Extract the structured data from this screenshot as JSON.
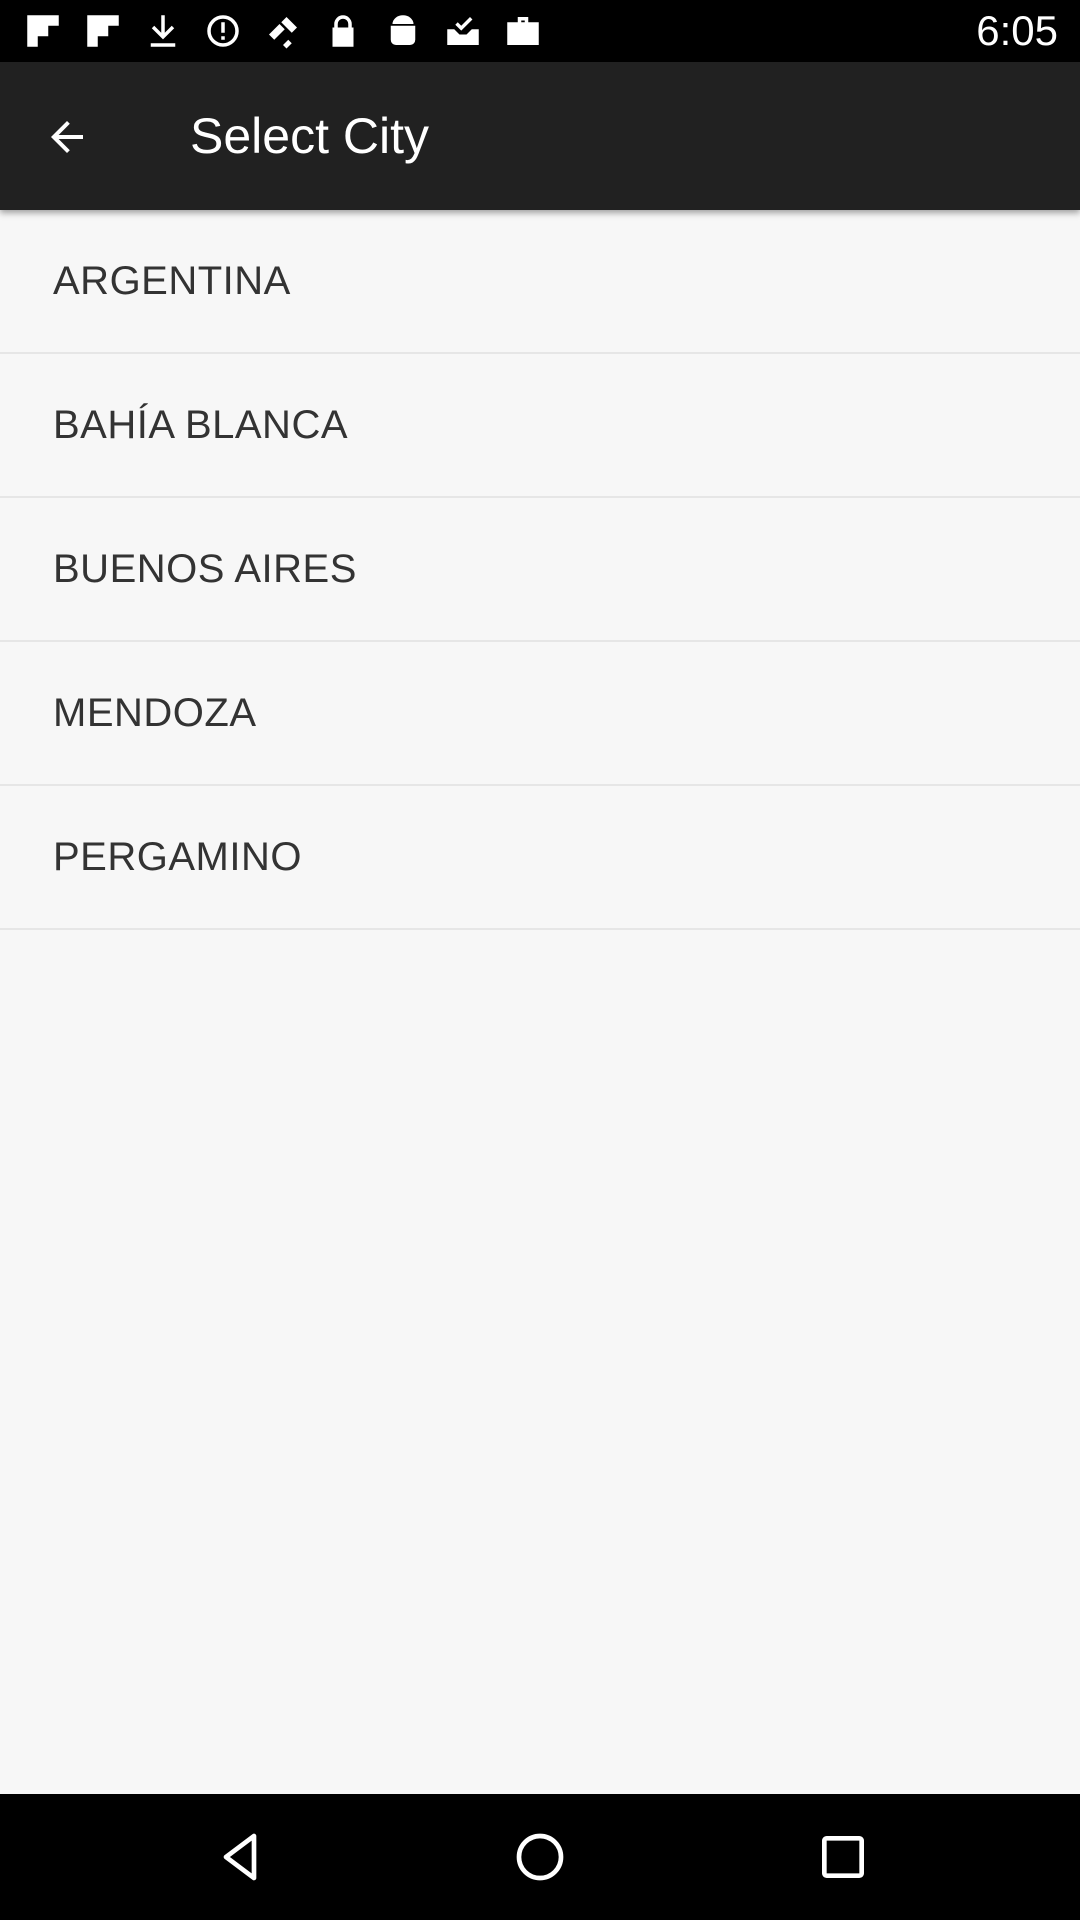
{
  "status_bar": {
    "time": "6:05",
    "icons": [
      "flipboard-icon",
      "flipboard-icon",
      "download-icon",
      "sync-disabled-icon",
      "fake-gps-icon",
      "lock-icon",
      "android-icon",
      "task-done-icon",
      "briefcase-icon"
    ]
  },
  "app_bar": {
    "title": "Select City",
    "back_icon": "arrow-back-icon"
  },
  "cities": [
    {
      "label": "ARGENTINA"
    },
    {
      "label": "BAHÍA BLANCA"
    },
    {
      "label": "BUENOS AIRES"
    },
    {
      "label": "MENDOZA"
    },
    {
      "label": "PERGAMINO"
    }
  ],
  "nav_bar": {
    "icons": [
      "back-triangle-icon",
      "home-circle-icon",
      "recents-square-icon"
    ]
  },
  "colors": {
    "status_bar": "#000000",
    "app_bar": "#212121",
    "background": "#f7f7f7",
    "divider": "#e6e6e6",
    "item_text": "#333333"
  }
}
